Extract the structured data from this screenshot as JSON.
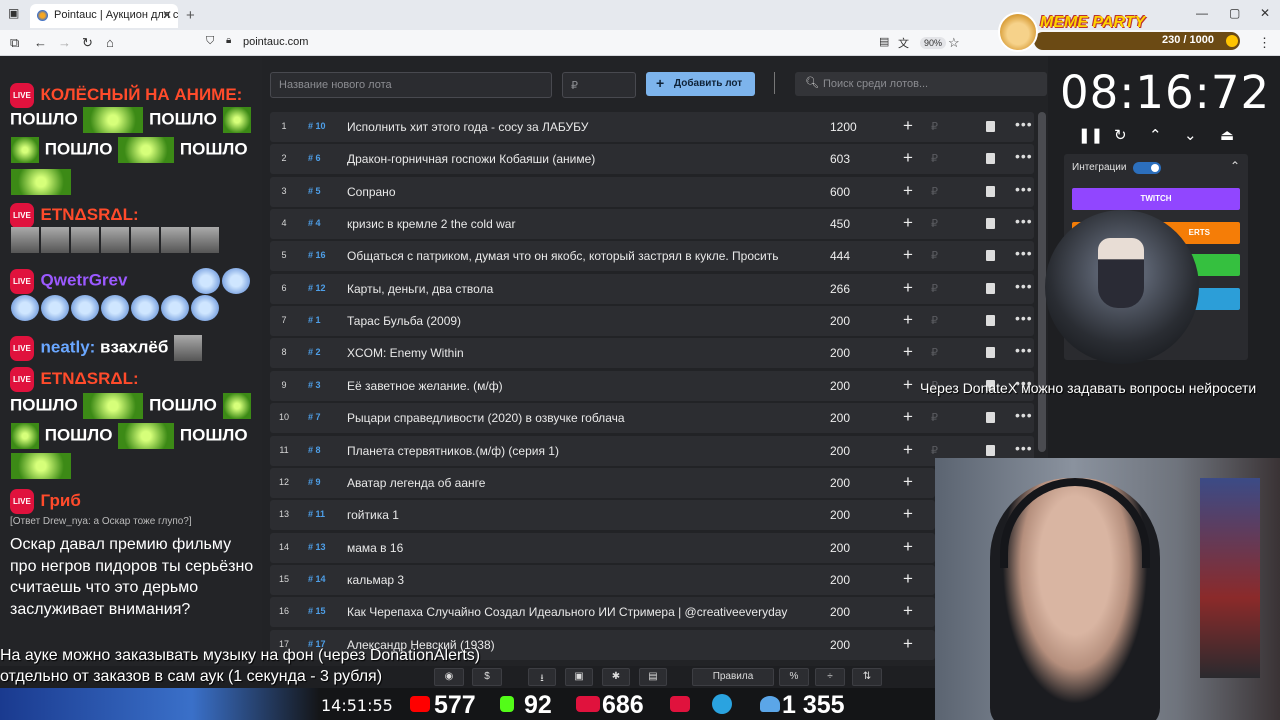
{
  "browser": {
    "tab_title": "Pointauc | Аукцион для стримеров",
    "tab_close": "✕",
    "new_tab": "+",
    "url": "pointauc.com",
    "zoom": "90%",
    "win_min": "—",
    "win_max": "▢",
    "win_close": "✕"
  },
  "meme": {
    "title": "MEME PARTY",
    "count": "230 / 1000"
  },
  "chat": {
    "messages": [
      {
        "name": "КОЛЁСНЫЙ НА АНИМЕ:",
        "color": "#ff4b2b"
      },
      {
        "name": "ЕТNΔSRΔL:",
        "color": "#ff4b2b"
      },
      {
        "name": "QwetrGrev",
        "color": "#9b59ff"
      },
      {
        "name": "neatly:",
        "color": "#6aa7ff"
      },
      {
        "name": "ЕТNΔSRΔL:",
        "color": "#ff4b2b"
      },
      {
        "name": "Гриб",
        "color": "#ff4b2b"
      }
    ],
    "word_poshlo": "ПОШЛО",
    "neatly_text": "взахлёб",
    "reply": "[Ответ Drew_nya: а Оскар тоже глупо?]",
    "last_text": "Оскар давал премию фильму про негров пидоров ты серьёзно считаешь что это дерьмо заслуживает внимания?",
    "live": "LIVE"
  },
  "main": {
    "new_lot_placeholder": "Название нового лота",
    "amount_placeholder": "₽",
    "add_button": "Добавить лот",
    "search_placeholder": "Поиск среди лотов...",
    "rows": [
      {
        "num": "1",
        "id": "# 10",
        "name": "Исполнить хит этого года - сосу за ЛАБУБУ",
        "amount": "1200"
      },
      {
        "num": "2",
        "id": "# 6",
        "name": "Дракон-горничная госпожи Кобаяши (аниме)",
        "amount": "603"
      },
      {
        "num": "3",
        "id": "# 5",
        "name": "Сопрано",
        "amount": "600"
      },
      {
        "num": "4",
        "id": "# 4",
        "name": "кризис в кремле 2 the cold war",
        "amount": "450"
      },
      {
        "num": "5",
        "id": "# 16",
        "name": "Общаться с патриком, думая что он якобс, который застрял в кукле. Просить",
        "amount": "444"
      },
      {
        "num": "6",
        "id": "# 12",
        "name": "Карты, деньги, два ствола",
        "amount": "266"
      },
      {
        "num": "7",
        "id": "# 1",
        "name": "Тарас Бульба (2009)",
        "amount": "200"
      },
      {
        "num": "8",
        "id": "# 2",
        "name": "XCOM: Enemy Within",
        "amount": "200"
      },
      {
        "num": "9",
        "id": "# 3",
        "name": "Её заветное желание. (м/ф)",
        "amount": "200"
      },
      {
        "num": "10",
        "id": "# 7",
        "name": "Рыцари справедливости (2020) в озвучке гоблача",
        "amount": "200"
      },
      {
        "num": "11",
        "id": "# 8",
        "name": "Планета стервятников.(м/ф) (серия 1)",
        "amount": "200"
      },
      {
        "num": "12",
        "id": "# 9",
        "name": "Аватар легенда об аанге",
        "amount": "200"
      },
      {
        "num": "13",
        "id": "# 11",
        "name": "гойтика 1",
        "amount": "200"
      },
      {
        "num": "14",
        "id": "# 13",
        "name": "мама в 16",
        "amount": "200"
      },
      {
        "num": "15",
        "id": "# 14",
        "name": "кальмар 3",
        "amount": "200"
      },
      {
        "num": "16",
        "id": "# 15",
        "name": "Как Черепаха Случайно Создал Идеального ИИ Стримера | @creativeeveryday",
        "amount": "200"
      },
      {
        "num": "17",
        "id": "# 17",
        "name": "Александр Невский (1938)",
        "amount": "200"
      }
    ],
    "plus": "+",
    "rub": "₽",
    "more": "•••"
  },
  "timer": {
    "value": "08:16:72",
    "integrations_label": "Интеграции",
    "twitch": "TWITCH",
    "alerts": "ERTS",
    "colors": {
      "twitch": "#9146ff",
      "alerts": "#f57d07",
      "green": "#35c03f",
      "blue": "#2c9ed8"
    }
  },
  "overlay": "Через DonateX можно задавать вопросы нейросети",
  "subtitles": {
    "line1": "На ауке можно заказывать музыку на фон (через DonationAlerts)",
    "line2": "отдельно от заказов в сам аук (1 секунда - 3 рубля)"
  },
  "toolbar": {
    "rules": "Правила",
    "percent": "%",
    "dollar": "$"
  },
  "stats": {
    "clock": "14:51:55",
    "youtube": "577",
    "kick": "92",
    "vk": "686",
    "telegram_users": "1 355"
  }
}
